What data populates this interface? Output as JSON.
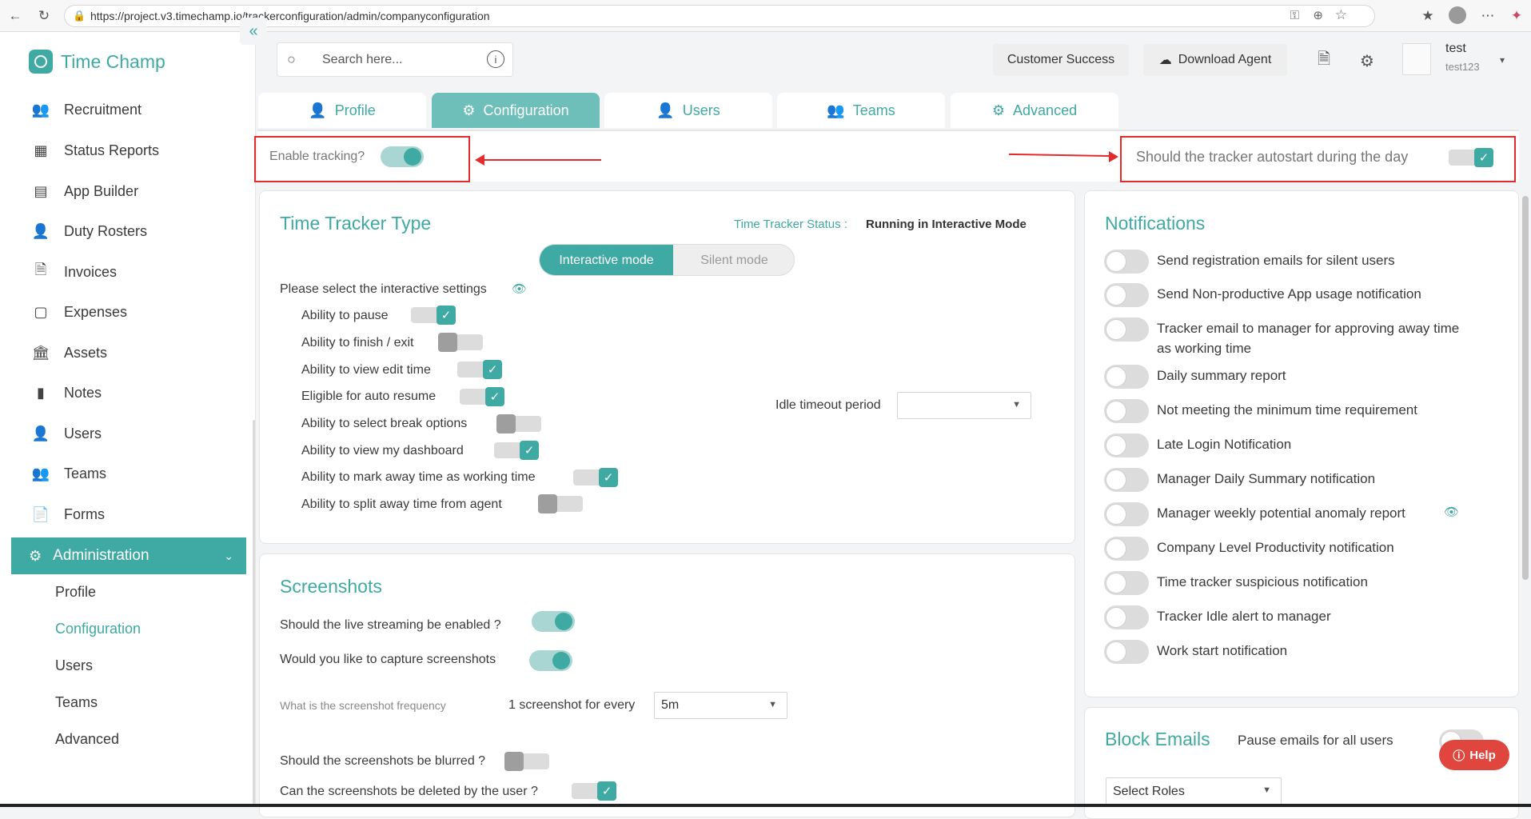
{
  "browser": {
    "url": "https://project.v3.timechamp.io/trackerconfiguration/admin/companyconfiguration"
  },
  "app": {
    "name": "Time Champ"
  },
  "sidebar": {
    "items": [
      {
        "label": "Recruitment",
        "icon": "recruitment-icon"
      },
      {
        "label": "Status Reports",
        "icon": "status-reports-icon"
      },
      {
        "label": "App Builder",
        "icon": "app-builder-icon"
      },
      {
        "label": "Duty Rosters",
        "icon": "duty-rosters-icon"
      },
      {
        "label": "Invoices",
        "icon": "invoices-icon"
      },
      {
        "label": "Expenses",
        "icon": "expenses-icon"
      },
      {
        "label": "Assets",
        "icon": "assets-icon"
      },
      {
        "label": "Notes",
        "icon": "notes-icon"
      },
      {
        "label": "Users",
        "icon": "users-icon"
      },
      {
        "label": "Teams",
        "icon": "teams-icon"
      },
      {
        "label": "Forms",
        "icon": "forms-icon"
      }
    ],
    "admin": {
      "label": "Administration"
    },
    "subitems": [
      "Profile",
      "Configuration",
      "Users",
      "Teams",
      "Advanced"
    ],
    "active_subitem": "Configuration"
  },
  "header": {
    "search_placeholder": "Search here...",
    "customer_success": "Customer Success",
    "download_agent": "Download Agent",
    "user_name": "test",
    "user_sub": "test123"
  },
  "tabs": [
    "Profile",
    "Configuration",
    "Users",
    "Teams",
    "Advanced"
  ],
  "active_tab": "Configuration",
  "tracking": {
    "enable_label": "Enable tracking?",
    "enable_on": true,
    "autostart_label": "Should the tracker autostart during the day",
    "autostart_on": true
  },
  "tracker_type": {
    "title": "Time Tracker Type",
    "status_label": "Time Tracker Status :",
    "status_value": "Running in Interactive Mode",
    "mode_interactive": "Interactive mode",
    "mode_silent": "Silent mode",
    "selected_mode": "Interactive mode",
    "settings_label": "Please select the interactive settings",
    "settings": [
      {
        "label": "Ability to pause",
        "on": true
      },
      {
        "label": "Ability to finish / exit",
        "on": false
      },
      {
        "label": "Ability to view edit time",
        "on": true
      },
      {
        "label": "Eligible for auto resume",
        "on": true
      },
      {
        "label": "Ability to select break options",
        "on": false
      },
      {
        "label": "Ability to view my dashboard",
        "on": true
      },
      {
        "label": "Ability to mark away time as working time",
        "on": true
      },
      {
        "label": "Ability to split away time from agent",
        "on": false
      }
    ],
    "idle_label": "Idle timeout period",
    "idle_value": ""
  },
  "screenshots": {
    "title": "Screenshots",
    "live_label": "Should the live streaming be enabled ?",
    "live_on": true,
    "capture_label": "Would you like to capture screenshots",
    "capture_on": true,
    "freq_label": "What is the screenshot frequency",
    "freq_prefix": "1 screenshot for every",
    "freq_value": "5m",
    "blur_label": "Should the screenshots be blurred ?",
    "blur_on": false,
    "delete_label": "Can the screenshots be deleted by the user ?",
    "delete_on": true
  },
  "notifications": {
    "title": "Notifications",
    "items": [
      {
        "label": "Send registration emails for silent users",
        "on": false
      },
      {
        "label": "Send Non-productive App usage notification",
        "on": false
      },
      {
        "label": "Tracker email to manager for approving away time",
        "label2": "as working time",
        "on": false
      },
      {
        "label": "Daily summary report",
        "on": false
      },
      {
        "label": "Not meeting the minimum time requirement",
        "on": false
      },
      {
        "label": "Late Login Notification",
        "on": false
      },
      {
        "label": "Manager Daily Summary notification",
        "on": false
      },
      {
        "label": "Manager weekly potential anomaly report",
        "on": false
      },
      {
        "label": "Company Level Productivity notification",
        "on": false
      },
      {
        "label": "Time tracker suspicious notification",
        "on": false
      },
      {
        "label": "Tracker Idle alert to manager",
        "on": false
      },
      {
        "label": "Work start notification",
        "on": false
      }
    ]
  },
  "block_emails": {
    "title": "Block Emails",
    "pause_label": "Pause emails for all users",
    "roles_placeholder": "Select Roles"
  },
  "help": {
    "label": "Help"
  },
  "colors": {
    "accent": "#3fa9a3",
    "accent_light": "#a9d6d2",
    "annotation_red": "#e42a2a",
    "help_red": "#e0463d"
  }
}
